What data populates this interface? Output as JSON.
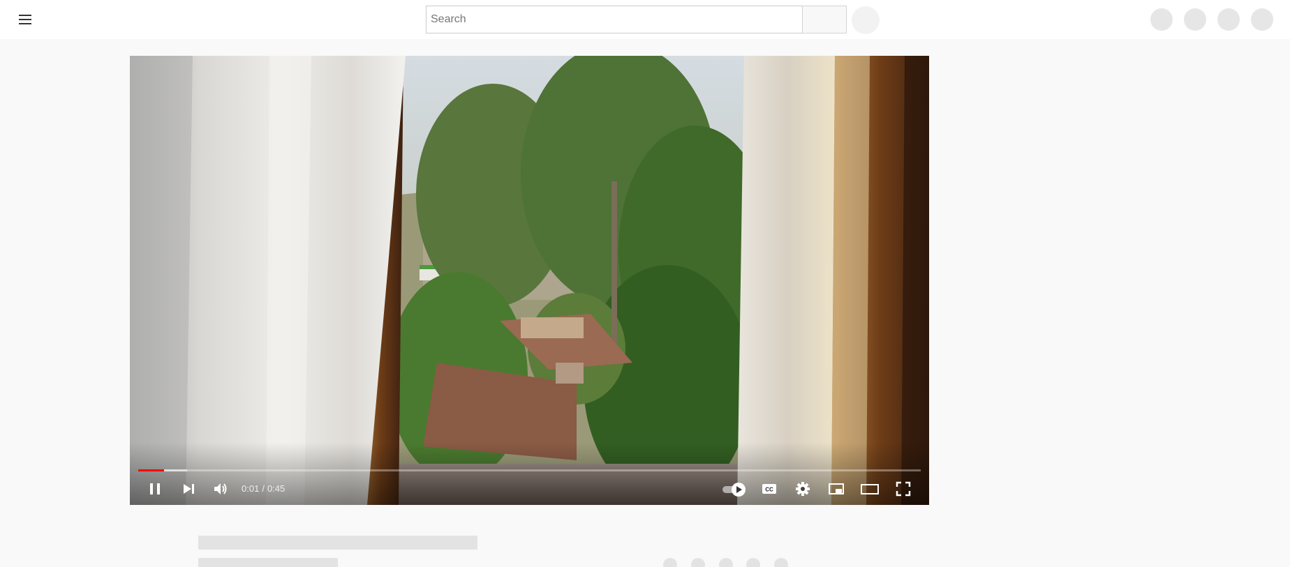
{
  "masthead": {
    "search": {
      "placeholder": "Search",
      "value": ""
    },
    "icons": {
      "menu": "hamburger-menu-icon",
      "search_button": "search-button",
      "mic": "microphone-button",
      "right": [
        "create-icon",
        "apps-icon",
        "notifications-icon",
        "avatar"
      ]
    }
  },
  "player": {
    "time": {
      "current": "0:01",
      "separator": "/",
      "duration": "0:45"
    },
    "progress": {
      "played_fraction": 0.033,
      "buffered_fraction": 0.062,
      "played_color": "#ff0000"
    },
    "controls": {
      "left": [
        "pause-icon",
        "next-icon",
        "volume-icon"
      ],
      "right": [
        "autoplay-toggle",
        "captions-icon",
        "settings-icon",
        "miniplayer-icon",
        "theater-mode-icon",
        "fullscreen-icon"
      ]
    },
    "autoplay_on": true
  },
  "loading_placeholder": {
    "state": "loading"
  }
}
